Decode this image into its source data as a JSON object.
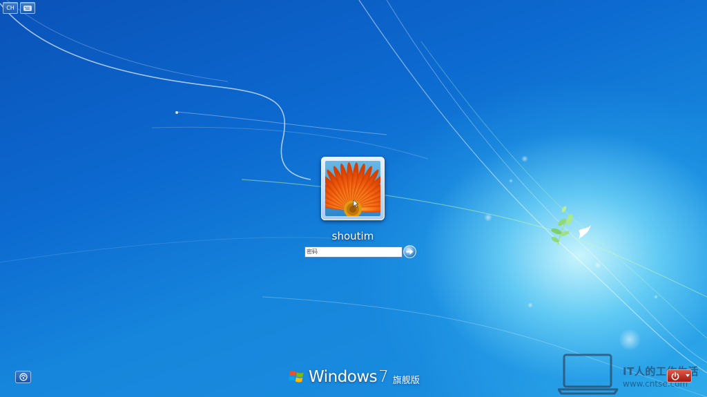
{
  "top_buttons": {
    "language_label": "CH",
    "keyboard_icon": "keyboard-icon"
  },
  "user": {
    "name": "shoutim",
    "tile_picture": "orange-flower-picture"
  },
  "password": {
    "placeholder": "密码",
    "value": ""
  },
  "icons": {
    "submit": "arrow-right-icon",
    "ease_of_access": "ease-of-access-icon",
    "shutdown": "power-icon",
    "windows_logo": "windows-flag-logo",
    "decoration": "bird-and-leaves-icon"
  },
  "branding": {
    "name": "Windows",
    "version": "7",
    "edition": "旗舰版"
  },
  "watermark": {
    "title": "IT人的工作生活",
    "url": "www.cntse.com"
  },
  "colors": {
    "background_dark": "#0a52b8",
    "background_light": "#1c8fe0",
    "shutdown_red": "#c0281a",
    "flower_orange": "#f06010"
  }
}
